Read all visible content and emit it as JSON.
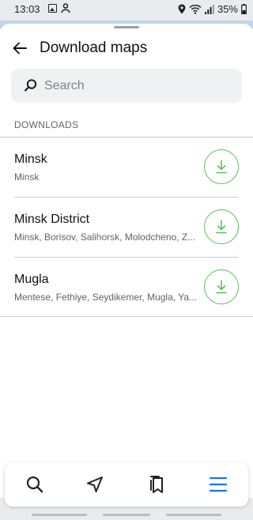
{
  "status_bar": {
    "time": "13:03",
    "battery": "35%"
  },
  "header": {
    "title": "Download maps"
  },
  "search": {
    "placeholder": "Search",
    "value": ""
  },
  "section": {
    "label": "DOWNLOADS"
  },
  "downloads": [
    {
      "name": "Minsk",
      "regions": "Minsk"
    },
    {
      "name": "Minsk District",
      "regions": "Minsk, Borisov, Salihorsk, Molodcheno, Z..."
    },
    {
      "name": "Mugla",
      "regions": "Mentese, Fethiye, Seydikemer, Mugla, Ya..."
    }
  ],
  "colors": {
    "download_accent": "#5bbf5a",
    "menu_accent": "#1a73e8"
  },
  "icons": {
    "back": "arrow-left-icon",
    "search": "search-icon",
    "download": "download-icon",
    "nav": [
      "search-icon",
      "navigation-arrow-icon",
      "bookmarks-icon",
      "menu-icon"
    ]
  }
}
